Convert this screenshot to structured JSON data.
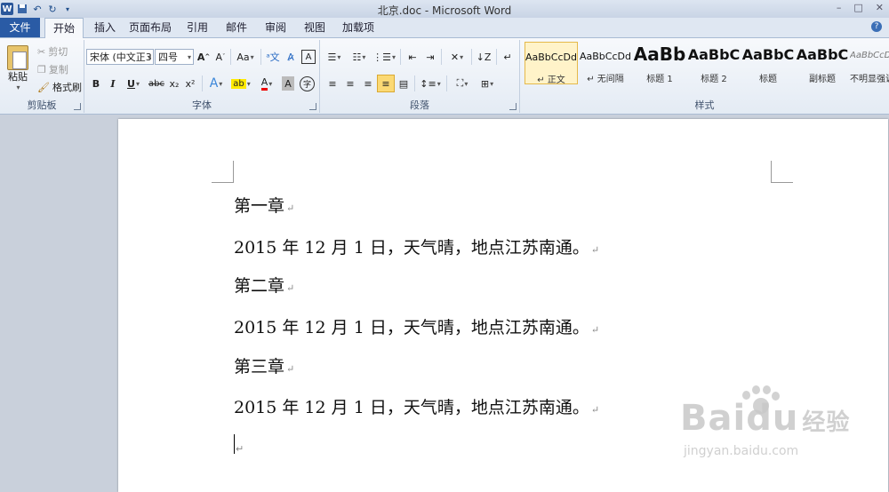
{
  "window": {
    "title": "北京.doc - Microsoft Word"
  },
  "quick_access": {
    "icons": [
      "word-icon",
      "save-icon",
      "undo-icon",
      "redo-icon",
      "customize-icon"
    ]
  },
  "tabs": [
    "文件",
    "开始",
    "插入",
    "页面布局",
    "引用",
    "邮件",
    "审阅",
    "视图",
    "加载项"
  ],
  "ribbon": {
    "clipboard": {
      "paste": "粘贴",
      "cut": "剪切",
      "copy": "复制",
      "format_painter": "格式刷",
      "label": "剪贴板"
    },
    "font": {
      "font_name": "宋体 (中文正3",
      "font_size": "四号",
      "label": "字体",
      "bold": "B",
      "italic": "I",
      "underline": "U",
      "strike": "abc",
      "subscript": "x₂",
      "superscript": "x²",
      "change_case": "Aa"
    },
    "paragraph": {
      "label": "段落"
    },
    "styles": {
      "label": "样式",
      "items": [
        {
          "preview": "AaBbCcDd",
          "name": "↵ 正文"
        },
        {
          "preview": "AaBbCcDd",
          "name": "↵ 无间隔"
        },
        {
          "preview": "AaBb",
          "name": "标题 1"
        },
        {
          "preview": "AaBbC",
          "name": "标题 2"
        },
        {
          "preview": "AaBbC",
          "name": "标题"
        },
        {
          "preview": "AaBbC",
          "name": "副标题"
        },
        {
          "preview": "AaBbCcDd",
          "name": "不明显强调"
        }
      ]
    }
  },
  "document": {
    "lines": [
      "第一章",
      "2015 年 12 月 1 日，天气晴，地点江苏南通。",
      "第二章",
      "2015 年 12 月 1 日，天气晴，地点江苏南通。",
      "第三章",
      "2015 年 12 月 1 日，天气晴，地点江苏南通。"
    ],
    "paragraph_mark": "↵"
  },
  "watermark": {
    "brand": "Baidu",
    "brand_cn": "经验",
    "url": "jingyan.baidu.com"
  }
}
